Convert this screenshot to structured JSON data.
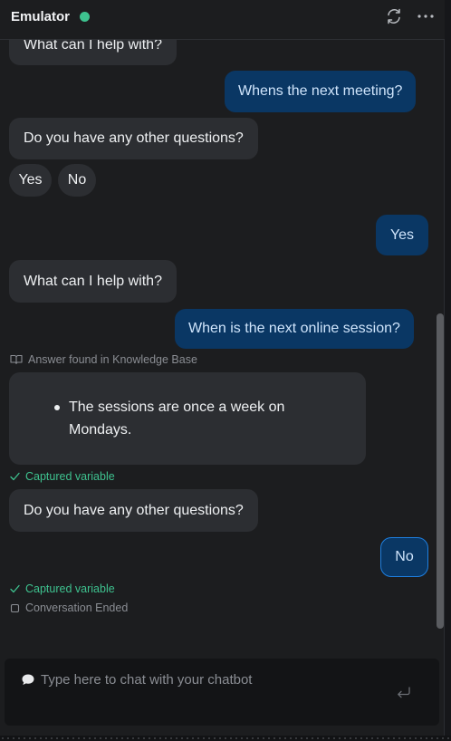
{
  "header": {
    "title": "Emulator",
    "status_color": "#3ec28f",
    "refresh_icon": "refresh-icon",
    "more_icon": "more-horizontal-icon"
  },
  "conversation": {
    "bot_1": "What can I help with?",
    "user_1": "Whens the next meeting?",
    "bot_2": "Do you have any other questions?",
    "choice_yes": "Yes",
    "choice_no": "No",
    "user_2": "Yes",
    "bot_3": "What can I help with?",
    "user_3": "When is the next online session?",
    "kb_note": "Answer found in Knowledge Base",
    "kb_answer": "The sessions are once a week on Mondays.",
    "captured_1": "Captured variable",
    "bot_4": "Do you have any other questions?",
    "user_4": "No",
    "captured_2": "Captured variable",
    "ended": "Conversation Ended"
  },
  "input": {
    "placeholder": "Type here to chat with your chatbot",
    "value": ""
  },
  "colors": {
    "background": "#1c1d1f",
    "bot_bubble": "#2c2e32",
    "user_bubble": "#0a3764",
    "accent_green": "#3ec28f"
  }
}
